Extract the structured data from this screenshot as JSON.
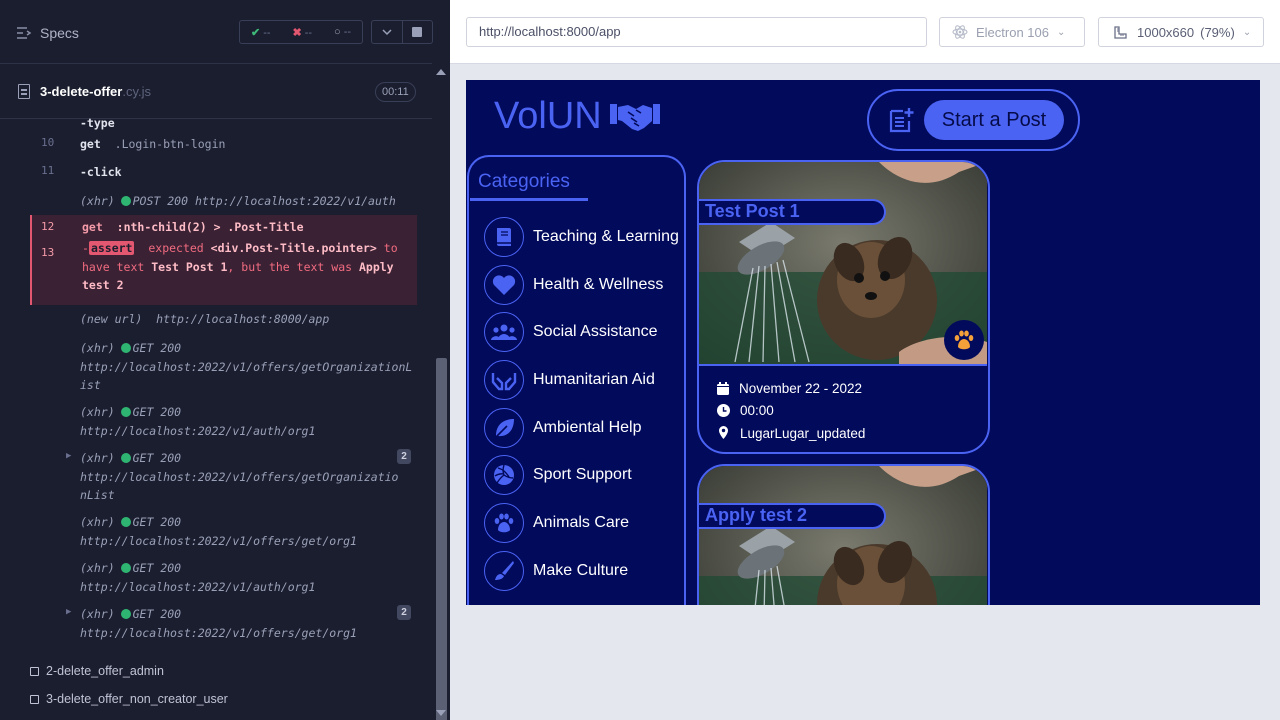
{
  "reporter": {
    "specs_label": "Specs",
    "stats": {
      "passed": "--",
      "failed": "--",
      "pending": "--"
    },
    "file": {
      "name": "3-delete-offer",
      "ext": ".cy.js",
      "duration": "00:11"
    },
    "commands": {
      "c10": {
        "num": "10",
        "name": "get",
        "selector": ".Login-btn-login"
      },
      "c11": {
        "num": "11",
        "name": "-click"
      },
      "c_xhr_post": {
        "type": "(xhr)",
        "method": "POST 200",
        "url": "http://localhost:2022/v1/auth"
      },
      "c12": {
        "num": "12",
        "name": "get",
        "selector": ":nth-child(2) > .Post-Title"
      },
      "c13": {
        "num": "13",
        "dash": "-",
        "badge": "assert",
        "p1": "expected",
        "p2": "<div.Post-Title.pointer>",
        "p3": "to have text",
        "p4": "Test Post 1",
        "p5": ", but the text was",
        "p6": "Apply test 2"
      },
      "c_newurl": {
        "type": "(new url)",
        "url": "http://localhost:8000/app"
      },
      "c_x1": {
        "type": "(xhr)",
        "method": "GET 200",
        "url": "http://localhost:2022/v1/offers/getOrganizationList"
      },
      "c_x2": {
        "type": "(xhr)",
        "method": "GET 200",
        "url": "http://localhost:2022/v1/auth/org1"
      },
      "c_x3": {
        "type": "(xhr)",
        "method": "GET 200",
        "url": "http://localhost:2022/v1/offers/getOrganizationList",
        "count": "2"
      },
      "c_x4": {
        "type": "(xhr)",
        "method": "GET 200",
        "url": "http://localhost:2022/v1/offers/get/org1"
      },
      "c_x5": {
        "type": "(xhr)",
        "method": "GET 200",
        "url": "http://localhost:2022/v1/auth/org1"
      },
      "c_x6": {
        "type": "(xhr)",
        "method": "GET 200",
        "url": "http://localhost:2022/v1/offers/get/org1",
        "count": "2"
      }
    },
    "specs": [
      "2-delete_offer_admin",
      "3-delete_offer_non_creator_user"
    ]
  },
  "aut": {
    "url": "http://localhost:8000/app",
    "browser": "Electron 106",
    "viewport": "1000x660",
    "zoom": "(79%)"
  },
  "app": {
    "logo": "VolUN",
    "start_post": "Start a Post",
    "categories_title": "Categories",
    "categories": [
      {
        "label": "Teaching & Learning",
        "icon": "book-icon"
      },
      {
        "label": "Health & Wellness",
        "icon": "heart-icon"
      },
      {
        "label": "Social Assistance",
        "icon": "people-icon"
      },
      {
        "label": "Humanitarian Aid",
        "icon": "hands-icon"
      },
      {
        "label": "Ambiental Help",
        "icon": "leaf-icon"
      },
      {
        "label": "Sport Support",
        "icon": "volleyball-icon"
      },
      {
        "label": "Animals Care",
        "icon": "paw-icon"
      },
      {
        "label": "Make Culture",
        "icon": "paintbrush-icon"
      }
    ],
    "posts": [
      {
        "title": "Test Post 1",
        "date": "November 22 - 2022",
        "time": "00:00",
        "location": "LugarLugar_updated",
        "category_icon": "paw-icon"
      },
      {
        "title": "Apply test 2"
      }
    ],
    "colors": {
      "accent": "#4a63f3",
      "background": "#020a5c",
      "paw": "#f5a13a"
    }
  }
}
